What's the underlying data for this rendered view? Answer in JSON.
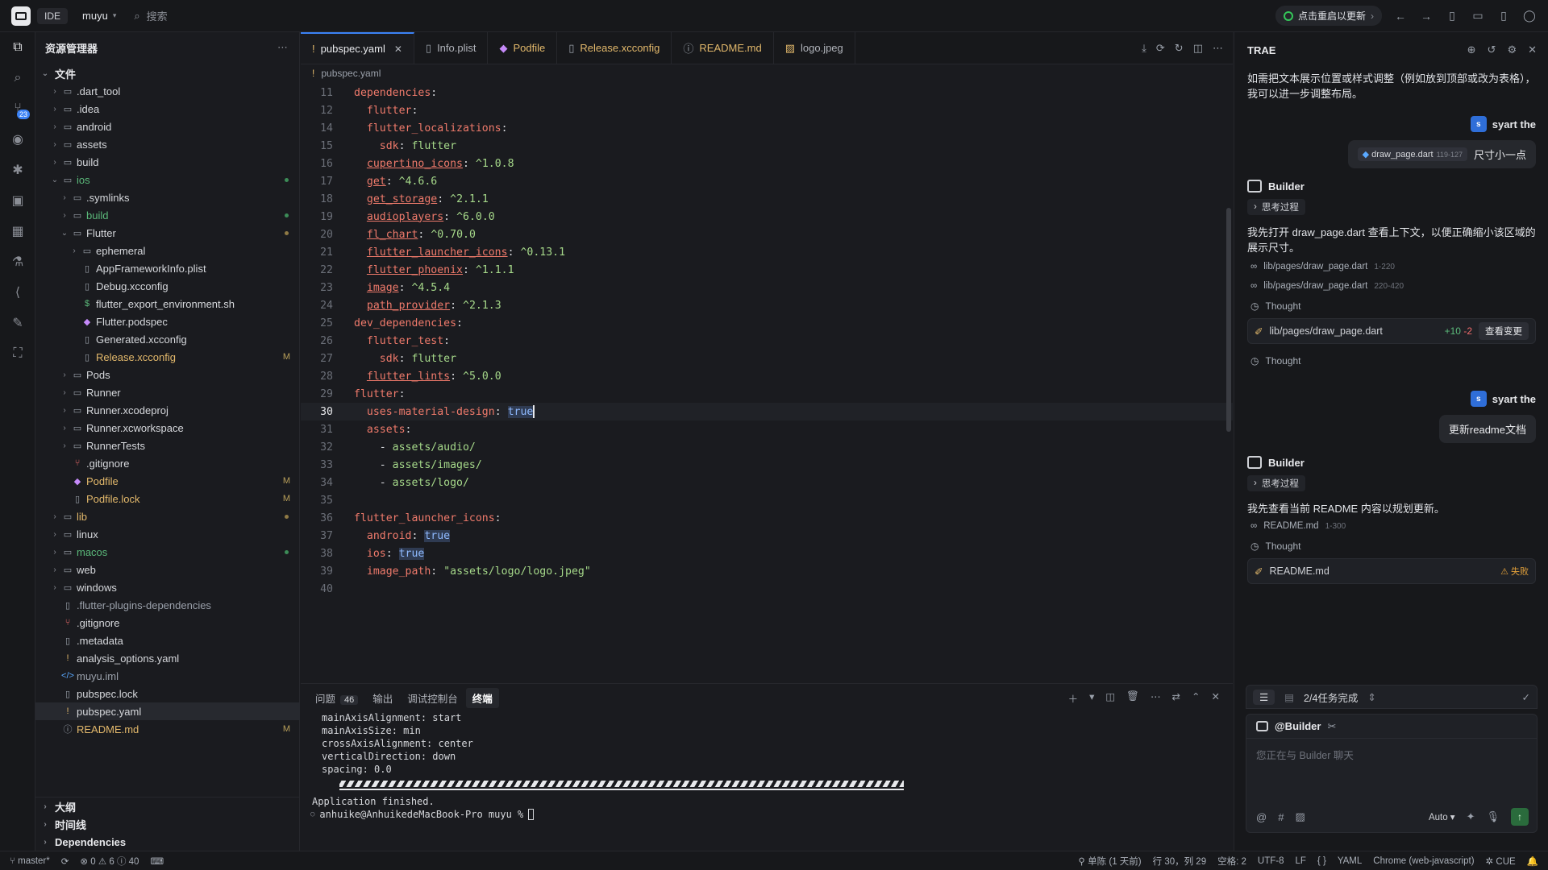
{
  "titlebar": {
    "ide_label": "IDE",
    "project": "muyu",
    "search_placeholder": "搜索",
    "restart_label": "点击重启以更新"
  },
  "activity": {
    "badge": "23"
  },
  "explorer": {
    "title": "资源管理器",
    "root": "文件",
    "items": [
      {
        "label": ".dart_tool",
        "kind": "folder",
        "depth": 1,
        "open": false
      },
      {
        "label": ".idea",
        "kind": "folder",
        "depth": 1,
        "open": false
      },
      {
        "label": "android",
        "kind": "folder",
        "depth": 1,
        "open": false
      },
      {
        "label": "assets",
        "kind": "folder",
        "depth": 1,
        "open": false
      },
      {
        "label": "build",
        "kind": "folder",
        "depth": 1,
        "open": false
      },
      {
        "label": "ios",
        "kind": "folder",
        "depth": 1,
        "open": true,
        "color": "green",
        "dot": true
      },
      {
        "label": ".symlinks",
        "kind": "folder",
        "depth": 2,
        "open": false
      },
      {
        "label": "build",
        "kind": "folder",
        "depth": 2,
        "open": false,
        "color": "green",
        "dot": true
      },
      {
        "label": "Flutter",
        "kind": "folder",
        "depth": 2,
        "open": true,
        "mod_dot": true
      },
      {
        "label": "ephemeral",
        "kind": "folder",
        "depth": 3,
        "open": false
      },
      {
        "label": "AppFrameworkInfo.plist",
        "kind": "file",
        "depth": 3
      },
      {
        "label": "Debug.xcconfig",
        "kind": "file",
        "depth": 3
      },
      {
        "label": "flutter_export_environment.sh",
        "kind": "shell",
        "depth": 3
      },
      {
        "label": "Flutter.podspec",
        "kind": "pod",
        "depth": 3
      },
      {
        "label": "Generated.xcconfig",
        "kind": "file",
        "depth": 3
      },
      {
        "label": "Release.xcconfig",
        "kind": "file",
        "depth": 3,
        "color": "mod",
        "status": "M"
      },
      {
        "label": "Pods",
        "kind": "folder",
        "depth": 2,
        "open": false
      },
      {
        "label": "Runner",
        "kind": "folder",
        "depth": 2,
        "open": false
      },
      {
        "label": "Runner.xcodeproj",
        "kind": "folder",
        "depth": 2,
        "open": false
      },
      {
        "label": "Runner.xcworkspace",
        "kind": "folder",
        "depth": 2,
        "open": false
      },
      {
        "label": "RunnerTests",
        "kind": "folder",
        "depth": 2,
        "open": false
      },
      {
        "label": ".gitignore",
        "kind": "git",
        "depth": 2
      },
      {
        "label": "Podfile",
        "kind": "pod",
        "depth": 2,
        "color": "mod",
        "status": "M"
      },
      {
        "label": "Podfile.lock",
        "kind": "file",
        "depth": 2,
        "color": "mod",
        "status": "M"
      },
      {
        "label": "lib",
        "kind": "folder",
        "depth": 1,
        "open": false,
        "color": "mod",
        "mod_dot": true
      },
      {
        "label": "linux",
        "kind": "folder",
        "depth": 1,
        "open": false
      },
      {
        "label": "macos",
        "kind": "folder",
        "depth": 1,
        "open": false,
        "color": "green",
        "dot": true
      },
      {
        "label": "web",
        "kind": "folder",
        "depth": 1,
        "open": false
      },
      {
        "label": "windows",
        "kind": "folder",
        "depth": 1,
        "open": false
      },
      {
        "label": ".flutter-plugins-dependencies",
        "kind": "file",
        "depth": 1,
        "color": "dim"
      },
      {
        "label": ".gitignore",
        "kind": "git",
        "depth": 1
      },
      {
        "label": ".metadata",
        "kind": "file",
        "depth": 1
      },
      {
        "label": "analysis_options.yaml",
        "kind": "yaml",
        "depth": 1
      },
      {
        "label": "muyu.iml",
        "kind": "xml",
        "depth": 1,
        "color": "dim"
      },
      {
        "label": "pubspec.lock",
        "kind": "file",
        "depth": 1
      },
      {
        "label": "pubspec.yaml",
        "kind": "yaml",
        "depth": 1,
        "selected": true
      },
      {
        "label": "README.md",
        "kind": "info",
        "depth": 1,
        "color": "mod",
        "status": "M"
      }
    ],
    "sections": [
      "大纲",
      "时间线",
      "Dependencies"
    ]
  },
  "editor": {
    "tabs": [
      {
        "label": "pubspec.yaml",
        "icon": "!",
        "active": true
      },
      {
        "label": "Info.plist",
        "icon": "file"
      },
      {
        "label": "Podfile",
        "icon": "pod",
        "color": "mod"
      },
      {
        "label": "Release.xcconfig",
        "icon": "file",
        "color": "mod"
      },
      {
        "label": "README.md",
        "icon": "info",
        "color": "mod"
      },
      {
        "label": "logo.jpeg",
        "icon": "img"
      }
    ],
    "breadcrumb": "pubspec.yaml",
    "lines": [
      {
        "n": "11",
        "i": 0,
        "t": [
          [
            "k",
            "dependencies"
          ],
          [
            "w",
            ":"
          ]
        ]
      },
      {
        "n": "12",
        "i": 1,
        "t": [
          [
            "k",
            "flutter"
          ],
          [
            "w",
            ":"
          ]
        ]
      },
      {
        "n": "14",
        "i": 1,
        "t": [
          [
            "k",
            "flutter_localizations"
          ],
          [
            "w",
            ":"
          ]
        ]
      },
      {
        "n": "15",
        "i": 2,
        "t": [
          [
            "k",
            "sdk"
          ],
          [
            "w",
            ": "
          ],
          [
            "v",
            "flutter"
          ]
        ]
      },
      {
        "n": "16",
        "i": 1,
        "t": [
          [
            "ku",
            "cupertino_icons"
          ],
          [
            "w",
            ": "
          ],
          [
            "v",
            "^1.0.8"
          ]
        ]
      },
      {
        "n": "17",
        "i": 1,
        "t": [
          [
            "ku",
            "get"
          ],
          [
            "w",
            ": "
          ],
          [
            "v",
            "^4.6.6"
          ]
        ]
      },
      {
        "n": "18",
        "i": 1,
        "t": [
          [
            "ku",
            "get_storage"
          ],
          [
            "w",
            ": "
          ],
          [
            "v",
            "^2.1.1"
          ]
        ]
      },
      {
        "n": "19",
        "i": 1,
        "t": [
          [
            "ku",
            "audioplayers"
          ],
          [
            "w",
            ": "
          ],
          [
            "v",
            "^6.0.0"
          ]
        ]
      },
      {
        "n": "20",
        "i": 1,
        "t": [
          [
            "ku",
            "fl_chart"
          ],
          [
            "w",
            ": "
          ],
          [
            "v",
            "^0.70.0"
          ]
        ]
      },
      {
        "n": "21",
        "i": 1,
        "t": [
          [
            "ku",
            "flutter_launcher_icons"
          ],
          [
            "w",
            ": "
          ],
          [
            "v",
            "^0.13.1"
          ]
        ]
      },
      {
        "n": "22",
        "i": 1,
        "t": [
          [
            "ku",
            "flutter_phoenix"
          ],
          [
            "w",
            ": "
          ],
          [
            "v",
            "^1.1.1"
          ]
        ]
      },
      {
        "n": "23",
        "i": 1,
        "t": [
          [
            "ku",
            "image"
          ],
          [
            "w",
            ": "
          ],
          [
            "v",
            "^4.5.4"
          ]
        ]
      },
      {
        "n": "24",
        "i": 1,
        "t": [
          [
            "ku",
            "path_provider"
          ],
          [
            "w",
            ": "
          ],
          [
            "v",
            "^2.1.3"
          ]
        ]
      },
      {
        "n": "25",
        "i": 0,
        "t": [
          [
            "k",
            "dev_dependencies"
          ],
          [
            "w",
            ":"
          ]
        ]
      },
      {
        "n": "26",
        "i": 1,
        "t": [
          [
            "k",
            "flutter_test"
          ],
          [
            "w",
            ":"
          ]
        ]
      },
      {
        "n": "27",
        "i": 2,
        "t": [
          [
            "k",
            "sdk"
          ],
          [
            "w",
            ": "
          ],
          [
            "v",
            "flutter"
          ]
        ]
      },
      {
        "n": "28",
        "i": 1,
        "t": [
          [
            "ku",
            "flutter_lints"
          ],
          [
            "w",
            ": "
          ],
          [
            "v",
            "^5.0.0"
          ]
        ]
      },
      {
        "n": "29",
        "i": 0,
        "t": [
          [
            "k",
            "flutter"
          ],
          [
            "w",
            ":"
          ]
        ]
      },
      {
        "n": "30",
        "i": 1,
        "cur": true,
        "t": [
          [
            "k",
            "uses-material-design"
          ],
          [
            "w",
            ": "
          ],
          [
            "tv",
            "true"
          ]
        ]
      },
      {
        "n": "31",
        "i": 1,
        "t": [
          [
            "k",
            "assets"
          ],
          [
            "w",
            ":"
          ]
        ]
      },
      {
        "n": "32",
        "i": 2,
        "t": [
          [
            "w",
            "- "
          ],
          [
            "v",
            "assets/audio/"
          ]
        ]
      },
      {
        "n": "33",
        "i": 2,
        "t": [
          [
            "w",
            "- "
          ],
          [
            "v",
            "assets/images/"
          ]
        ]
      },
      {
        "n": "34",
        "i": 2,
        "t": [
          [
            "w",
            "- "
          ],
          [
            "v",
            "assets/logo/"
          ]
        ]
      },
      {
        "n": "35",
        "i": 0,
        "t": []
      },
      {
        "n": "36",
        "i": 0,
        "t": [
          [
            "k",
            "flutter_launcher_icons"
          ],
          [
            "w",
            ":"
          ]
        ]
      },
      {
        "n": "37",
        "i": 1,
        "t": [
          [
            "k",
            "android"
          ],
          [
            "w",
            ": "
          ],
          [
            "tv",
            "true"
          ]
        ]
      },
      {
        "n": "38",
        "i": 1,
        "t": [
          [
            "k",
            "ios"
          ],
          [
            "w",
            ": "
          ],
          [
            "tv",
            "true"
          ]
        ]
      },
      {
        "n": "39",
        "i": 1,
        "t": [
          [
            "k",
            "image_path"
          ],
          [
            "w",
            ": "
          ],
          [
            "s",
            "\"assets/logo/logo.jpeg\""
          ]
        ]
      },
      {
        "n": "40",
        "i": 0,
        "t": []
      }
    ]
  },
  "panel": {
    "tabs": {
      "problems": "问题",
      "problems_count": "46",
      "output": "输出",
      "debug": "调试控制台",
      "terminal": "终端"
    },
    "terminal_lines": [
      "mainAxisAlignment: start",
      "mainAxisSize: min",
      "crossAxisAlignment: center",
      "verticalDirection: down",
      "spacing: 0.0"
    ],
    "finished": "Application finished.",
    "prompt": "anhuike@AnhuikedeMacBook-Pro muyu % "
  },
  "ai": {
    "title": "TRAE",
    "intro": "如需把文本展示位置或样式调整（例如放到顶部或改为表格），我可以进一步调整布局。",
    "user_name": "syart the",
    "user_avatar": "s",
    "msg1_chip": "draw_page.dart",
    "msg1_chip_range": "119-127",
    "msg1_text": "尺寸小一点",
    "bot_name": "Builder",
    "think_label": "思考过程",
    "reply1": "我先打开 draw_page.dart 查看上下文，以便正确缩小该区域的展示尺寸。",
    "ref1": "lib/pages/draw_page.dart",
    "ref1_range": "1-220",
    "ref2": "lib/pages/draw_page.dart",
    "ref2_range": "220-420",
    "thought": "Thought",
    "edit_file": "lib/pages/draw_page.dart",
    "edit_add": "+10",
    "edit_del": "-2",
    "view_changes": "查看变更",
    "msg2_text": "更新readme文档",
    "reply2": "我先查看当前 README 内容以规划更新。",
    "ref3": "README.md",
    "ref3_range": "1-300",
    "edit2_file": "README.md",
    "edit2_status": "失败",
    "task_label": "2/4任务完成",
    "composer_agent": "@Builder",
    "composer_placeholder": "您正在与 Builder 聊天",
    "model": "Auto"
  },
  "status": {
    "branch": "master*",
    "errors": "0",
    "warnings": "6",
    "infos": "40",
    "author": "单陈 (1 天前)",
    "position": "行 30，列 29",
    "spaces": "空格: 2",
    "encoding": "UTF-8",
    "eol": "LF",
    "braces": "{ }",
    "language": "YAML",
    "browser": "Chrome (web-javascript)",
    "cue": "CUE"
  }
}
